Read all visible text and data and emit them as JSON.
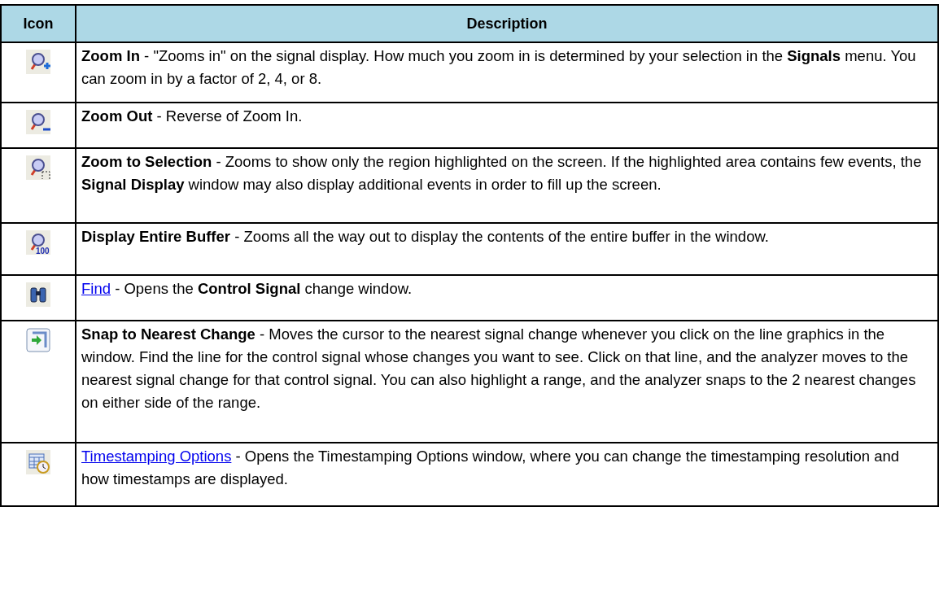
{
  "table": {
    "columns": [
      "Icon",
      "Description"
    ],
    "rows": [
      {
        "kind": "text",
        "description": "**Zoom In** - \"Zooms in\" on the signal display. How much you zoom in is determined by your selection in the **Signals** menu. You can zoom in by a factor of 2, 4, or 8."
      },
      {
        "kind": "text",
        "description": "**Zoom Out** - Reverse of Zoom In."
      },
      {
        "kind": "text",
        "description": "**Zoom to Selection** - Zooms to show only the region highlighted on the screen. If the highlighted area contains few events, the **Signal Display** window may also display additional events in order to fill up the screen."
      },
      {
        "kind": "text",
        "icon_label": "100",
        "description": "**Display Entire Buffer** - Zooms all the way out to display the contents of the entire buffer in the window."
      },
      {
        "kind": "link",
        "link": "Find",
        "description": " - Opens the **Control Signal** change window."
      },
      {
        "kind": "text",
        "description": "**Snap to Nearest Change** - Moves the cursor to the nearest signal change whenever you click on the line graphics in the window. Find the line for the control signal whose changes you want to see. Click on that line, and the analyzer moves to the nearest signal change for that control signal. You can also highlight a range, and the analyzer snaps to the 2 nearest changes on either side of the range."
      },
      {
        "kind": "link",
        "link": "Timestamping Options",
        "description": " - Opens the Timestamping Options window, where you can change the timestamping resolution and how timestamps are displayed."
      }
    ]
  }
}
